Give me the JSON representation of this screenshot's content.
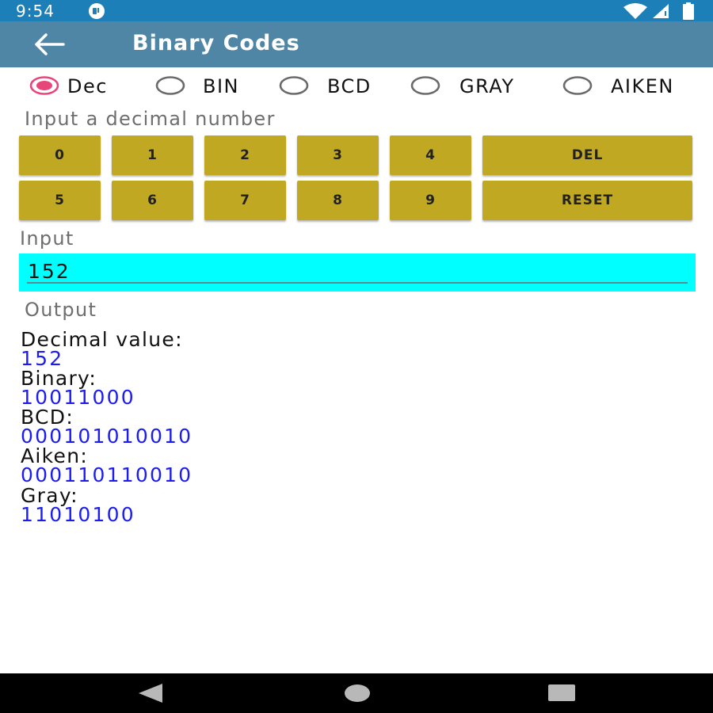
{
  "status": {
    "time": "9:54",
    "icons": [
      "app-notification-icon",
      "wifi-icon",
      "cell-signal-icon",
      "battery-icon"
    ]
  },
  "app_bar": {
    "title": "Binary Codes",
    "back_icon": "arrow-back-icon",
    "background_color": "#4f86a6"
  },
  "modes": {
    "selected": "Dec",
    "options": [
      "Dec",
      "BIN",
      "BCD",
      "GRAY",
      "AIKEN"
    ]
  },
  "hint": "Input a decimal number",
  "keypad": {
    "row1": [
      "0",
      "1",
      "2",
      "3",
      "4",
      "DEL"
    ],
    "row2": [
      "5",
      "6",
      "7",
      "8",
      "9",
      "RESET"
    ],
    "button_color": "#c1a823"
  },
  "input": {
    "label": "Input",
    "value": "152",
    "background_color": "#00ffff"
  },
  "output": {
    "label": "Output",
    "decimal_label": "Decimal value:",
    "decimal_value": "152",
    "binary_label": "Binary:",
    "binary_value": "10011000",
    "bcd_label": "BCD:",
    "bcd_value": "000101010010",
    "aiken_label": "Aiken:",
    "aiken_value": "000110110010",
    "gray_label": "Gray:",
    "gray_value": "11010100",
    "value_color": "#1c1cf2"
  },
  "nav": {
    "icons": [
      "back-triangle-icon",
      "home-circle-icon",
      "recents-square-icon"
    ]
  }
}
